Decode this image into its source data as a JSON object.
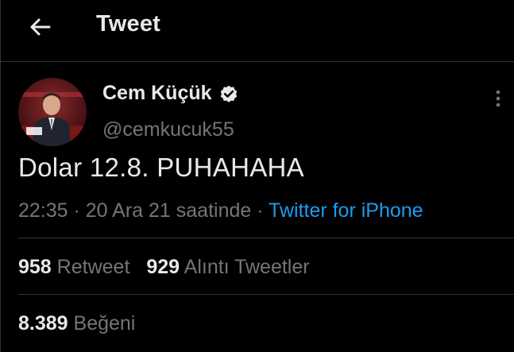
{
  "header": {
    "title": "Tweet",
    "back_icon": "back-arrow-icon"
  },
  "user": {
    "name": "Cem Küçük",
    "handle": "@cemkucuk55",
    "verified_icon": "verified-badge-icon"
  },
  "tweet": {
    "text": "Dolar 12.8. PUHAHAHA",
    "time": "22:35",
    "separator1": " · ",
    "date": "20 Ara 21 saatinde",
    "separator2": " · ",
    "source": "Twitter for iPhone"
  },
  "stats": {
    "retweet_count": "958",
    "retweet_label": "Retweet",
    "quote_count": "929",
    "quote_label": "Alıntı Tweetler",
    "like_count": "8.389",
    "like_label": "Beğeni"
  },
  "colors": {
    "background": "#000000",
    "text": "#e7e9ea",
    "muted": "#71767b",
    "link": "#1d9bf0",
    "divider": "#2f3336"
  }
}
